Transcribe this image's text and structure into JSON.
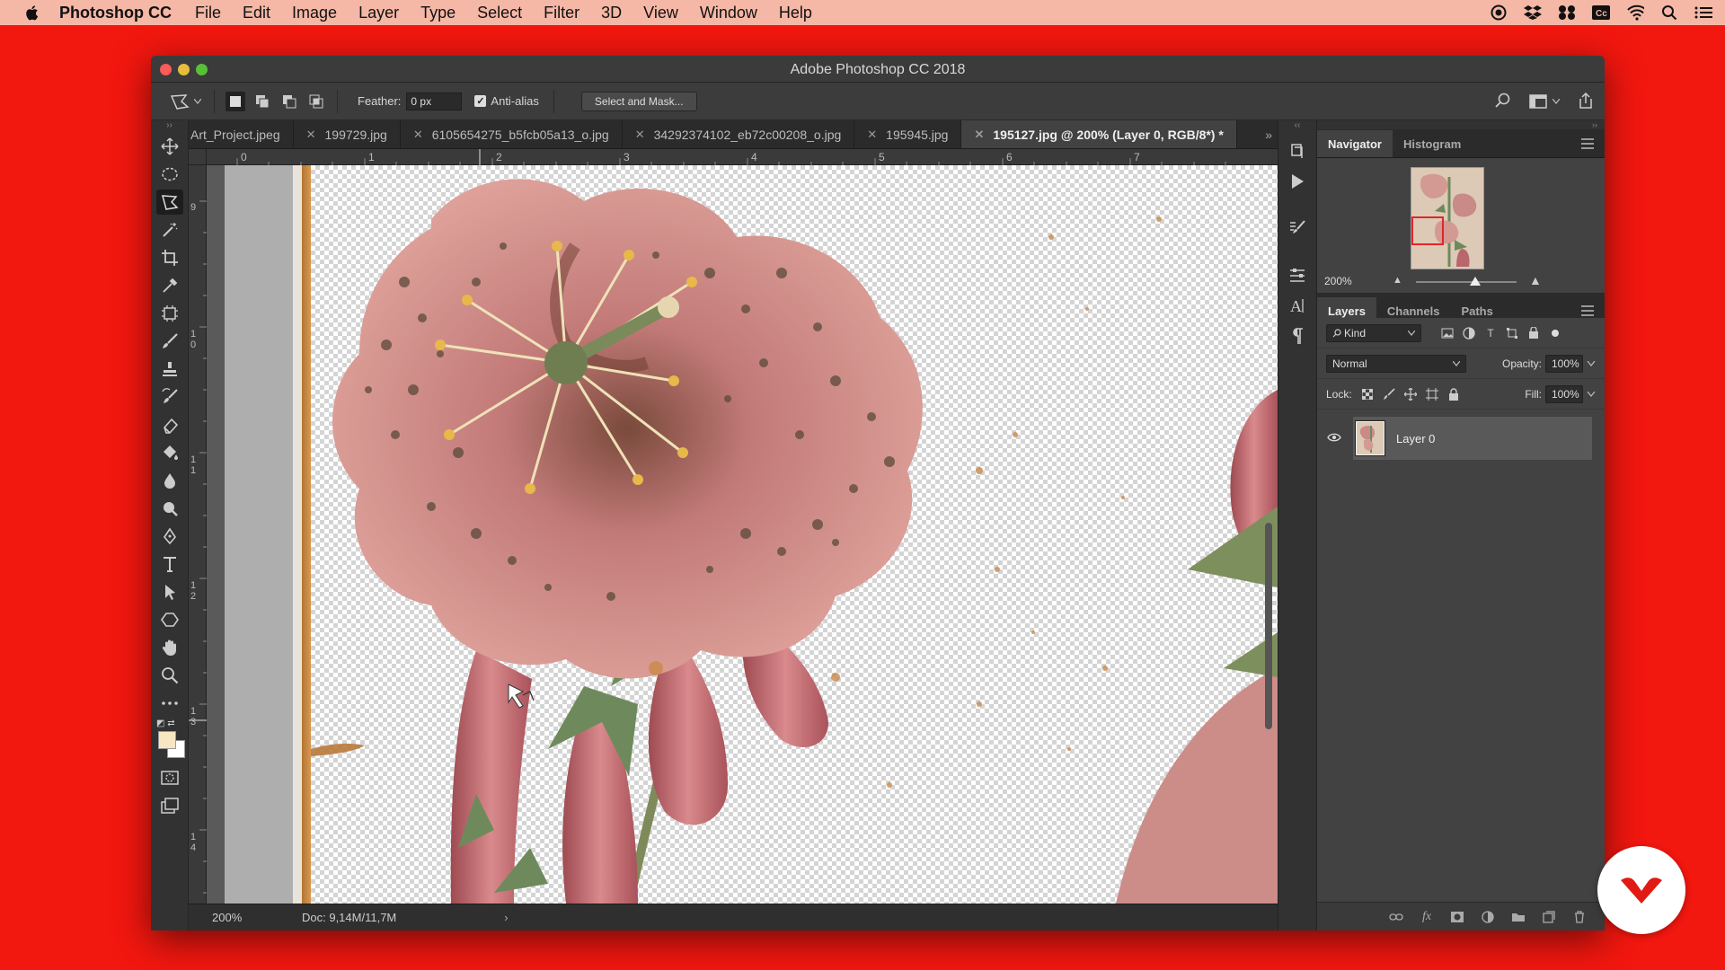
{
  "menubar": {
    "app_name": "Photoshop CC",
    "items": [
      "File",
      "Edit",
      "Image",
      "Layer",
      "Type",
      "Select",
      "Filter",
      "3D",
      "View",
      "Window",
      "Help"
    ]
  },
  "window": {
    "title": "Adobe Photoshop CC 2018"
  },
  "options": {
    "feather_label": "Feather:",
    "feather_value": "0 px",
    "antialias_label": "Anti-alias",
    "antialias_checked": true,
    "select_mask_label": "Select and Mask..."
  },
  "tabs": [
    {
      "label": "Art_Project.jpeg",
      "active": false
    },
    {
      "label": "199729.jpg",
      "active": false
    },
    {
      "label": "6105654275_b5fcb05a13_o.jpg",
      "active": false
    },
    {
      "label": "34292374102_eb72c00208_o.jpg",
      "active": false
    },
    {
      "label": "195945.jpg",
      "active": false
    },
    {
      "label": "195127.jpg @ 200% (Layer 0, RGB/8*) *",
      "active": true
    }
  ],
  "ruler": {
    "top_labels": [
      "0",
      "1",
      "2",
      "3",
      "4",
      "5",
      "6",
      "7"
    ],
    "left_labels": [
      "9",
      "1 0",
      "1 1",
      "1 2",
      "1 3",
      "1 4"
    ]
  },
  "status": {
    "zoom": "200%",
    "doc": "Doc: 9,14M/11,7M",
    "arrow": "›"
  },
  "navigator": {
    "tabs": [
      "Navigator",
      "Histogram"
    ],
    "zoom": "200%"
  },
  "layers_panel": {
    "tabs": [
      "Layers",
      "Channels",
      "Paths"
    ],
    "filter_kind": "Kind",
    "blend_mode": "Normal",
    "opacity_label": "Opacity:",
    "opacity_value": "100%",
    "lock_label": "Lock:",
    "fill_label": "Fill:",
    "fill_value": "100%",
    "layers": [
      {
        "name": "Layer 0",
        "visible": true
      }
    ]
  },
  "colors": {
    "foreground": "#f6e7c2",
    "background": "#ffffff",
    "desktop": "#f2170f",
    "menubar": "#f5b7a6"
  }
}
